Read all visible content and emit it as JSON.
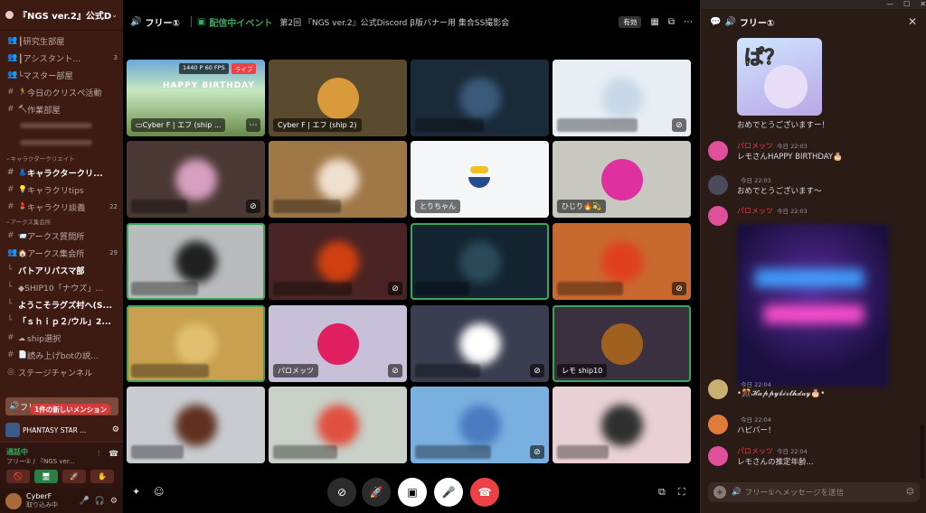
{
  "window": {
    "min": "—",
    "max": "☐",
    "close": "✕"
  },
  "server": {
    "name": "『NGS ver.2』公式Di...",
    "chevron": "⌄"
  },
  "channels": [
    {
      "type": "voice",
      "label": "┃研究生部屋",
      "count": ""
    },
    {
      "type": "voice",
      "label": "┃アシスタント...",
      "count": "3"
    },
    {
      "type": "voice",
      "label": "└マスター部屋",
      "count": ""
    },
    {
      "type": "text",
      "label": "今日のクリスぺ活動",
      "count": "",
      "emoji": "🏃"
    },
    {
      "type": "text",
      "label": "作業部屋",
      "count": "",
      "emoji": "🔨"
    },
    {
      "type": "blur"
    },
    {
      "type": "blur"
    },
    {
      "type": "category",
      "label": "キャラクタークリエイト"
    },
    {
      "type": "text",
      "label": "キャラクタークリ...",
      "count": "",
      "emoji": "👗",
      "bold": true
    },
    {
      "type": "text",
      "label": "キャラクリtips",
      "count": "",
      "emoji": "💡"
    },
    {
      "type": "text",
      "label": "キャラクリ談義",
      "count": "22",
      "emoji": "💄"
    },
    {
      "type": "category",
      "label": "アークス集会所"
    },
    {
      "type": "text",
      "label": "アークス質問所",
      "count": "",
      "emoji": "📨"
    },
    {
      "type": "voice",
      "label": "アークス集会所",
      "count": "29",
      "emoji": "🏠"
    },
    {
      "type": "thread",
      "label": "バトアリパスマ部",
      "bold": true
    },
    {
      "type": "thread",
      "label": "◆SHIP10「ナウズ」..."
    },
    {
      "type": "thread",
      "label": "ようこそラグズ村へ(S...",
      "bold": true
    },
    {
      "type": "thread",
      "label": "「ｓｈｉｐ２/ウル」2...",
      "bold": true
    },
    {
      "type": "text",
      "label": "ship選択",
      "count": "",
      "emoji": "☁"
    },
    {
      "type": "text",
      "label": "読み上げbotの説...",
      "count": "",
      "emoji": "📄"
    },
    {
      "type": "stage",
      "label": "ステージチャンネル"
    }
  ],
  "active_channel": {
    "label": "フリー①",
    "mention": "1件の新しいメンション"
  },
  "stream_row": {
    "label": "PHANTASY STAR ..."
  },
  "voice_panel": {
    "status": "通話中",
    "sub": "フリー① / 『NGS ver...",
    "buttons": [
      "🚫",
      "🖥",
      "🚀",
      "✋"
    ]
  },
  "user": {
    "name": "CyberF",
    "status": "取り込み中"
  },
  "topbar": {
    "voice_name": "フリー①",
    "event_label": "配信中イベント",
    "event_title": "第2回 『NGS ver.2』公式Discord β版バナー用 集合SS撮影会",
    "badge": "有効"
  },
  "tiles": [
    {
      "name": "Cyber F | エフ (ship ...",
      "stream": true,
      "quality": "1440 P 60 FPS",
      "live": "ライブ",
      "bg": "#8bb4a0",
      "av": "",
      "speaking": false,
      "mute": false,
      "hbd": "HAPPY BIRTHDAY"
    },
    {
      "name": "Cyber F | エフ (ship 2)",
      "bg": "#5a4a2e",
      "av": "#d89a3a",
      "speaking": false,
      "mute": false
    },
    {
      "name": "",
      "bg": "#1a2a38",
      "av": "#3a5a7a",
      "blur": true,
      "mute": false
    },
    {
      "name": "",
      "bg": "#e8eef4",
      "av": "#c8d8e8",
      "blur": true,
      "mute": true
    },
    {
      "name": "",
      "bg": "#4a3834",
      "av": "#d8a0c0",
      "blur": true,
      "mute": true
    },
    {
      "name": "",
      "bg": "#a07848",
      "av": "#f0e0d0",
      "blur": true,
      "mute": false
    },
    {
      "name": "とりちゃん",
      "bg": "#f4f6f8",
      "av": "",
      "mute": false,
      "duck": true
    },
    {
      "name": "ひじり🔥💫",
      "bg": "#c8c8c0",
      "av": "#e030a0",
      "mute": false
    },
    {
      "name": "",
      "bg": "#b8bcbc",
      "av": "#202020",
      "blur": true,
      "speaking": true,
      "mute": false
    },
    {
      "name": "",
      "bg": "#4a2424",
      "av": "#d04010",
      "blur": true,
      "mute": true
    },
    {
      "name": "",
      "bg": "#142430",
      "av": "#2a4a5a",
      "blur": true,
      "speaking": true,
      "mute": false
    },
    {
      "name": "",
      "bg": "#c86a30",
      "av": "#e04020",
      "blur": true,
      "mute": true
    },
    {
      "name": "",
      "bg": "#c8a050",
      "av": "#e0c070",
      "blur": true,
      "speaking": true,
      "mute": false
    },
    {
      "name": "パロメッツ",
      "bg": "#c8c0d8",
      "av": "#e02060",
      "mute": true
    },
    {
      "name": "",
      "bg": "#3a3e50",
      "av": "#ffffff",
      "blur": true,
      "mute": true
    },
    {
      "name": "レモ ship10",
      "bg": "#3a3040",
      "av": "#a06020",
      "speaking": true,
      "mute": false
    },
    {
      "name": "",
      "bg": "#c8ccd0",
      "av": "#603020",
      "blur": true,
      "mute": false
    },
    {
      "name": "",
      "bg": "#c8d0c8",
      "av": "#e05040",
      "blur": true,
      "mute": false
    },
    {
      "name": "",
      "bg": "#7ab0e0",
      "av": "#4a7ac0",
      "blur": true,
      "mute": true
    },
    {
      "name": "",
      "bg": "#e8d0d4",
      "av": "#303030",
      "blur": true,
      "mute": false
    }
  ],
  "chat": {
    "title": "フリー①",
    "sticker_text": "ぱ？",
    "messages": [
      {
        "text": "おめでとうございますー！",
        "name": "",
        "time": ""
      },
      {
        "name": "パロメッツ",
        "time": "今日 22:03",
        "text": "レモさんHAPPY BIRTHDAY🎂"
      },
      {
        "name": "",
        "time": "今日 22:03",
        "text": "おめでとうございます〜"
      },
      {
        "name": "パロメッツ",
        "time": "今日 22:03",
        "text": ""
      },
      {
        "name": "",
        "time": "今日 22:04",
        "text": "•🎊𝓗𝓪𝓹𝓹𝔂𝓫𝓲𝓻𝓽𝓱𝓭𝓪𝔂🎂•"
      },
      {
        "name": "",
        "time": "今日 22:04",
        "text": "ハピバー！"
      },
      {
        "name": "パロメッツ",
        "time": "今日 22:04",
        "text": "レモさんの推定年齢..."
      }
    ],
    "placeholder": "フリー①へメッセージを送信"
  }
}
